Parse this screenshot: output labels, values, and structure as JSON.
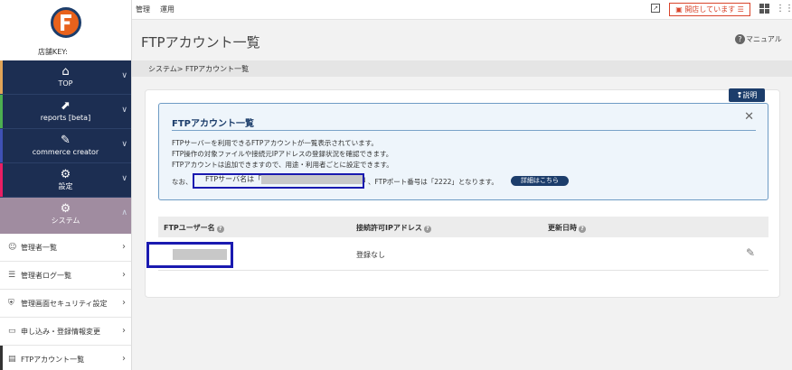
{
  "sidebar": {
    "store_key_label": "店舗KEY:",
    "nav": [
      {
        "label": "TOP",
        "icon": "home-icon",
        "glyph": "⌂",
        "accent": "#e0a458"
      },
      {
        "label": "reports [beta]",
        "icon": "chart-icon",
        "glyph": "⬈",
        "accent": "#4caf50"
      },
      {
        "label": "commerce creator",
        "icon": "wrench-icon",
        "glyph": "🔧",
        "accent": "#3f51b5"
      },
      {
        "label": "設定",
        "icon": "gear-icon",
        "glyph": "⚙",
        "accent": "#e91e63"
      },
      {
        "label": "システム",
        "icon": "gear-icon",
        "glyph": "⚙",
        "accent": "#a08ca0"
      }
    ],
    "sub_items": [
      {
        "label": "管理者一覧",
        "icon": "users-icon",
        "glyph": "☺"
      },
      {
        "label": "管理者ログ一覧",
        "icon": "log-icon",
        "glyph": "☰"
      },
      {
        "label": "管理画面セキュリティ設定",
        "icon": "shield-icon",
        "glyph": "⛨"
      },
      {
        "label": "申し込み・登録情報変更",
        "icon": "card-icon",
        "glyph": "▭"
      },
      {
        "label": "FTPアカウント一覧",
        "icon": "server-icon",
        "glyph": "▤"
      }
    ]
  },
  "topbar": {
    "link_manage": "管理",
    "link_operate": "運用",
    "open_status": "開店しています"
  },
  "header": {
    "title": "FTPアカウント一覧",
    "manual": "マニュアル",
    "breadcrumb": "システム> FTPアカウント一覧"
  },
  "info": {
    "help_label": "説明",
    "title": "FTPアカウント一覧",
    "line1": "FTPサーバーを利用できるFTPアカウントが一覧表示されています。",
    "line2": "FTP操作の対象ファイルや接続元IPアドレスの登録状況を確認できます。",
    "line3": "FTPアカウントは追加できますので、用途・利用者ごとに設定できます。",
    "prefix": "なお、",
    "server_label_before": "FTPサーバ名は「",
    "server_label_after": "」",
    "port_text": "、FTPポート番号は「2222」となります。",
    "detail_button": "詳細はこちら"
  },
  "table": {
    "headers": [
      "FTPユーザー名",
      "接続許可IPアドレス",
      "更新日時"
    ],
    "rows": [
      {
        "ip": "登録なし"
      }
    ]
  },
  "colors": {
    "sidebar_dark": "#1c2e52",
    "sidebar_system": "#a08ca0",
    "highlight": "#1a1ab0",
    "brand_orange": "#e8621c",
    "alert_red": "#d9442b"
  }
}
